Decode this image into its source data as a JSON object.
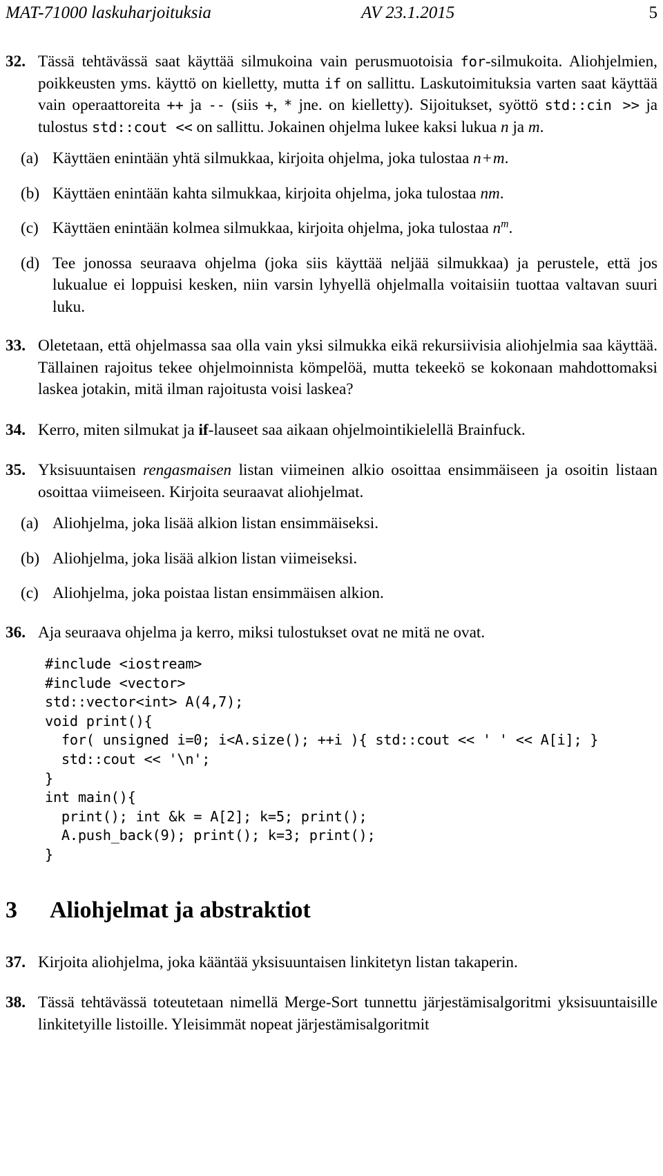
{
  "header": {
    "left": "MAT-71000 laskuharjoituksia",
    "center": "AV 23.1.2015",
    "page_number": "5"
  },
  "exercises": [
    {
      "number": "32.",
      "intro_parts": {
        "t1": "Tässä tehtävässä saat käyttää silmukoina vain perusmuotoisia ",
        "c1": "for",
        "t2": "-silmukoita. Aliohjelmien, poikkeusten yms. käyttö on kielletty, mutta ",
        "c2": "if",
        "t3": " on sallittu. Laskutoimituksia varten saat käyttää vain operaattoreita ",
        "c3": "++",
        "t4": " ja ",
        "c4": "--",
        "t5": " (siis ",
        "c5": "+",
        "t6": ", ",
        "c6": "*",
        "t7": " jne. on kielletty). Sijoitukset, syöttö ",
        "c7": "std::cin >>",
        "t8": " ja tulostus ",
        "c8": "std::cout <<",
        "t9": " on sallittu. Jokainen ohjelma lukee kaksi lukua ",
        "m1": "n",
        "t10": " ja ",
        "m2": "m",
        "t11": "."
      },
      "subitems": [
        {
          "mark": "(a)",
          "t1": "Käyttäen enintään yhtä silmukkaa, kirjoita ohjelma, joka tulostaa ",
          "m1": "n",
          "op": "+",
          "m2": "m",
          "t2": "."
        },
        {
          "mark": "(b)",
          "t1": "Käyttäen enintään kahta silmukkaa, kirjoita ohjelma, joka tulostaa ",
          "m1": "nm",
          "t2": "."
        },
        {
          "mark": "(c)",
          "t1": "Käyttäen enintään kolmea silmukkaa, kirjoita ohjelma, joka tulostaa ",
          "m1": "n",
          "exp": "m",
          "t2": "."
        },
        {
          "mark": "(d)",
          "t1": "Tee jonossa seuraava ohjelma (joka siis käyttää neljää silmukkaa) ja perustele, että jos lukualue ei loppuisi kesken, niin varsin lyhyellä ohjelmalla voitaisiin tuottaa valtavan suuri luku."
        }
      ]
    },
    {
      "number": "33.",
      "text": "Oletetaan, että ohjelmassa saa olla vain yksi silmukka eikä rekursiivisia aliohjelmia saa käyttää. Tällainen rajoitus tekee ohjelmoinnista kömpelöä, mutta tekeekö se kokonaan mahdottomaksi laskea jotakin, mitä ilman rajoitusta voisi laskea?"
    },
    {
      "number": "34.",
      "t1": "Kerro, miten silmukat ja ",
      "b1": "if",
      "t2": "-lauseet saa aikaan ohjelmointikielellä Brainfuck."
    },
    {
      "number": "35.",
      "t1": "Yksisuuntaisen ",
      "i1": "rengasmaisen",
      "t2": " listan viimeinen alkio osoittaa ensimmäiseen ja osoitin listaan osoittaa viimeiseen. Kirjoita seuraavat aliohjelmat.",
      "subitems": [
        {
          "mark": "(a)",
          "t1": "Aliohjelma, joka lisää alkion listan ensimmäiseksi."
        },
        {
          "mark": "(b)",
          "t1": "Aliohjelma, joka lisää alkion listan viimeiseksi."
        },
        {
          "mark": "(c)",
          "t1": "Aliohjelma, joka poistaa listan ensimmäisen alkion."
        }
      ]
    },
    {
      "number": "36.",
      "text": "Aja seuraava ohjelma ja kerro, miksi tulostukset ovat ne mitä ne ovat.",
      "code": "#include <iostream>\n#include <vector>\nstd::vector<int> A(4,7);\nvoid print(){\n  for( unsigned i=0; i<A.size(); ++i ){ std::cout << ' ' << A[i]; }\n  std::cout << '\\n';\n}\nint main(){\n  print(); int &k = A[2]; k=5; print();\n  A.push_back(9); print(); k=3; print();\n}"
    }
  ],
  "section": {
    "number": "3",
    "title": "Aliohjelmat ja abstraktiot"
  },
  "exercises_after_section": [
    {
      "number": "37.",
      "text": "Kirjoita aliohjelma, joka kääntää yksisuuntaisen linkitetyn listan takaperin."
    },
    {
      "number": "38.",
      "text": "Tässä tehtävässä toteutetaan nimellä Merge-Sort tunnettu järjestämisalgoritmi yksisuuntaisille linkitetyille listoille. Yleisimmät nopeat järjestämisalgoritmit"
    }
  ]
}
